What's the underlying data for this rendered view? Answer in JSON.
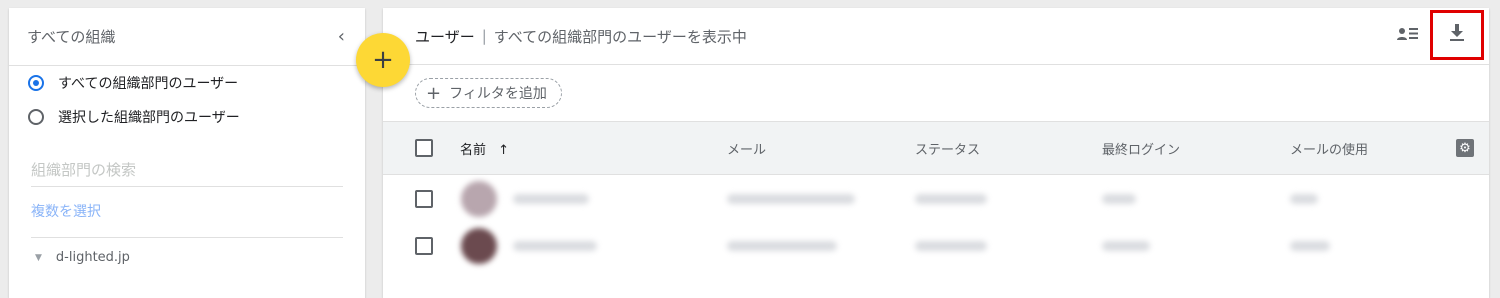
{
  "sidebar": {
    "title": "すべての組織",
    "collapse_icon": "‹",
    "options": [
      {
        "label": "すべての組織部門のユーザー",
        "selected": true
      },
      {
        "label": "選択した組織部門のユーザー",
        "selected": false
      }
    ],
    "search_placeholder": "組織部門の検索",
    "multi_select_label": "複数を選択",
    "org_tree": [
      {
        "label": "d-lighted.jp"
      }
    ]
  },
  "fab": {
    "label": "+"
  },
  "main": {
    "title": "ユーザー",
    "separator": "|",
    "subtitle": "すべての組織部門のユーザーを表示中",
    "header_icons": {
      "columns_icon": "person-list-icon",
      "download_icon": "download-icon"
    },
    "filter": {
      "label": "フィルタを追加",
      "icon": "+"
    },
    "table": {
      "columns": [
        {
          "label": "名前",
          "sorted": "ascending",
          "sort_icon": "↑"
        },
        {
          "label": "メール"
        },
        {
          "label": "ステータス"
        },
        {
          "label": "最終ログイン"
        },
        {
          "label": "メールの使用"
        }
      ],
      "row_count_visible": 2
    }
  },
  "colors": {
    "accent_blue": "#1a73e8",
    "fab_yellow": "#fdd835",
    "highlight_red": "#e00000",
    "link_blue": "#8ab4f8"
  }
}
